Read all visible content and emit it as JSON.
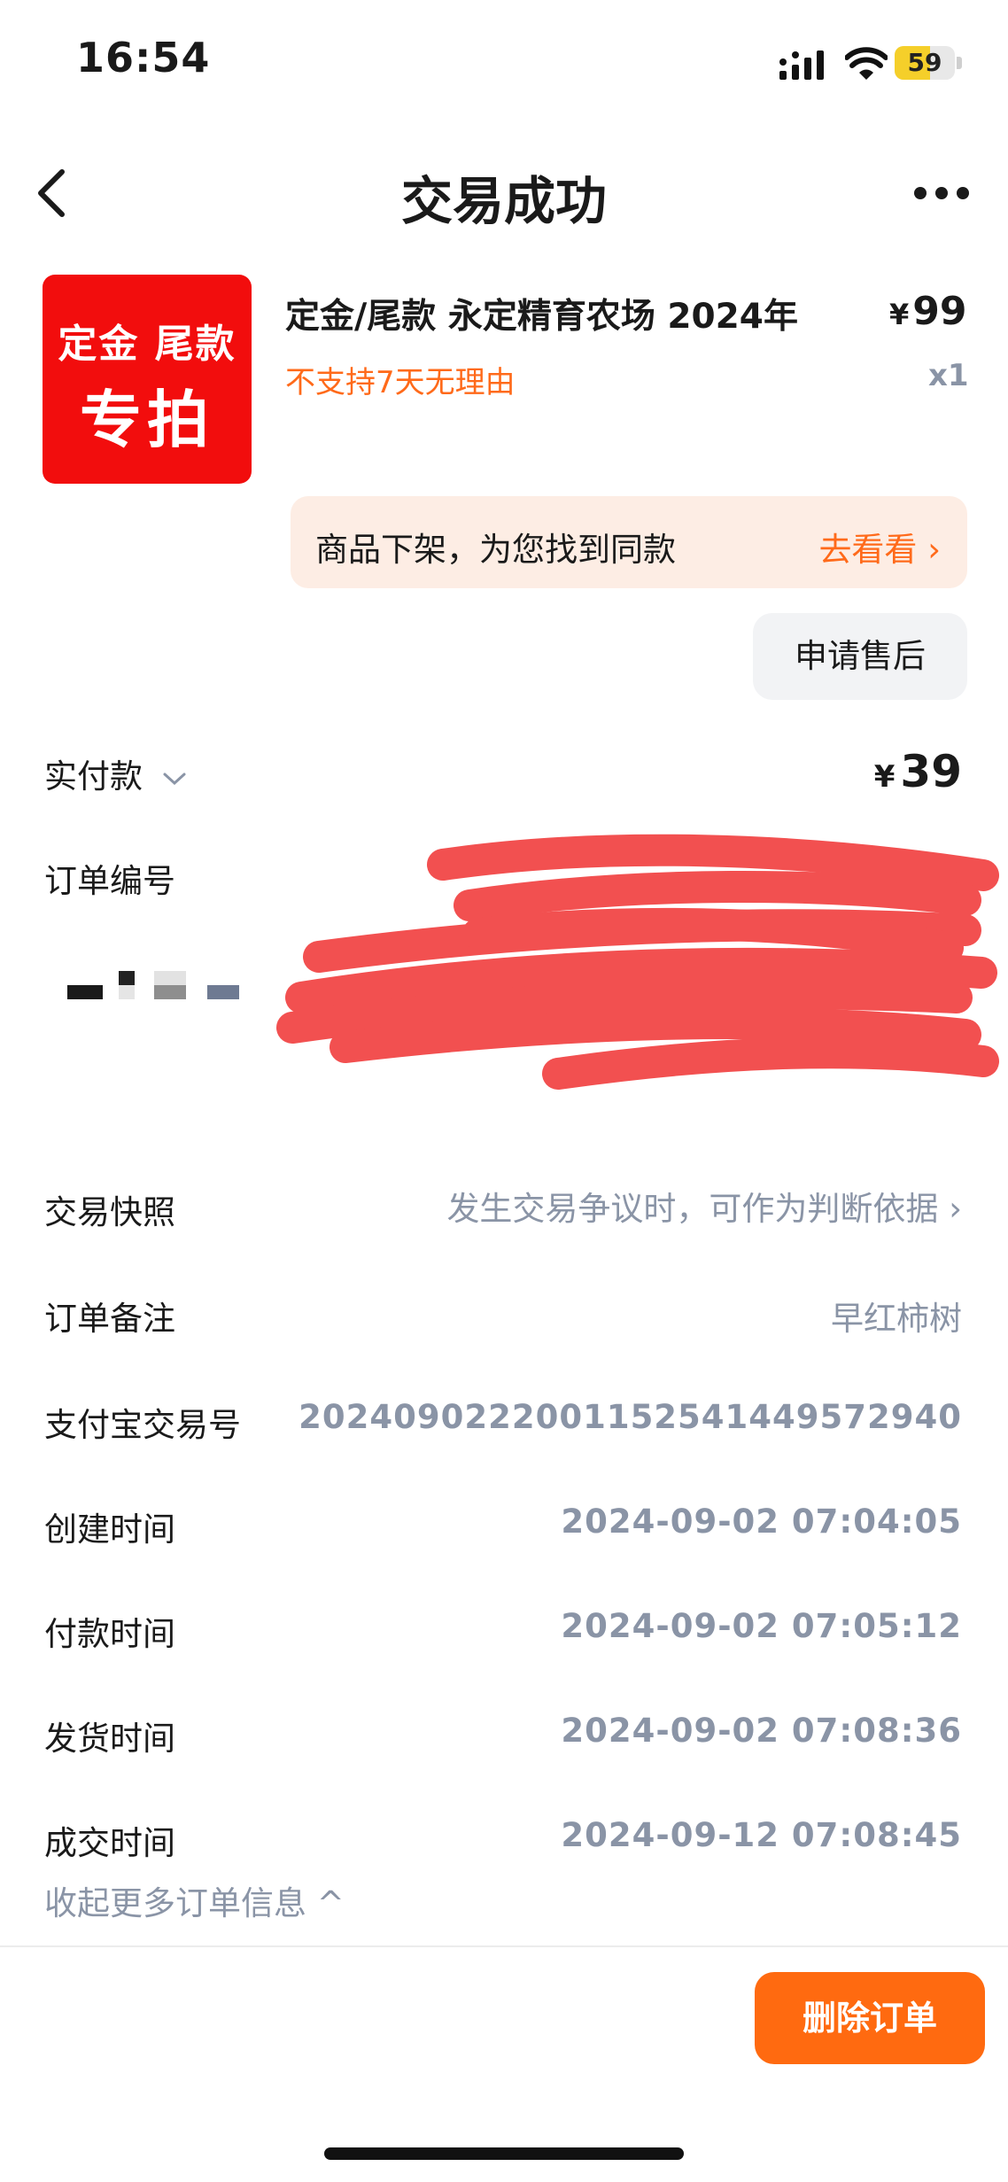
{
  "status_bar": {
    "time": "16:54",
    "battery": "59",
    "battery_fraction": 0.59
  },
  "nav": {
    "title": "交易成功"
  },
  "product": {
    "thumb_line1": "定金 尾款",
    "thumb_line2": "专拍",
    "title": "定金/尾款 永定精育农场 2024年",
    "currency": "¥",
    "price": "99",
    "warning": "不支持7天无理由",
    "quantity": "x1"
  },
  "similar_banner": {
    "text": "商品下架，为您找到同款",
    "link": "去看看 ›"
  },
  "after_sale_button": "申请售后",
  "paid": {
    "label": "实付款",
    "currency": "¥",
    "amount": "39"
  },
  "order_number": {
    "label": "订单编号",
    "copy_fragment": "制"
  },
  "rows": [
    {
      "label": "交易快照",
      "value": "发生交易争议时，可作为判断依据 ›"
    },
    {
      "label": "订单备注",
      "value": "早红柿树"
    },
    {
      "label": "支付宝交易号",
      "value": "2024090222001152541449572940"
    },
    {
      "label": "创建时间",
      "value": "2024-09-02 07:04:05"
    },
    {
      "label": "付款时间",
      "value": "2024-09-02 07:05:12"
    },
    {
      "label": "发货时间",
      "value": "2024-09-02 07:08:36"
    },
    {
      "label": "成交时间",
      "value": "2024-09-12 07:08:45"
    }
  ],
  "collapse_link": "收起更多订单信息 ^",
  "delete_button": "删除订单",
  "colors": {
    "accent": "#ff6a10",
    "thumb_red": "#f20d0d",
    "muted": "#8a94a6",
    "banner_bg": "#fdede4"
  }
}
